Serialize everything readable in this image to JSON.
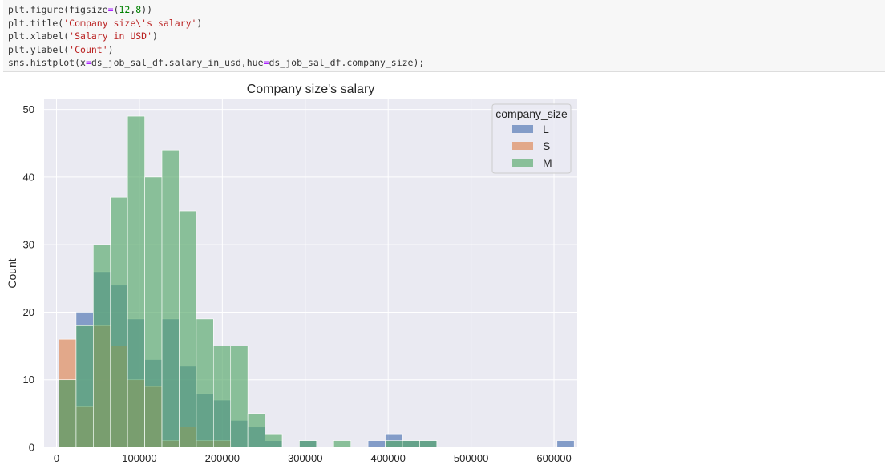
{
  "code": {
    "lines": [
      [
        {
          "t": "plt.figure(figsize",
          "c": ""
        },
        {
          "t": "=",
          "c": "eq"
        },
        {
          "t": "(",
          "c": ""
        },
        {
          "t": "12",
          "c": "num"
        },
        {
          "t": ",",
          "c": ""
        },
        {
          "t": "8",
          "c": "num"
        },
        {
          "t": "))",
          "c": ""
        }
      ],
      [
        {
          "t": "plt.title(",
          "c": ""
        },
        {
          "t": "'Company size\\'s salary'",
          "c": "str"
        },
        {
          "t": ")",
          "c": ""
        }
      ],
      [
        {
          "t": "plt.xlabel(",
          "c": ""
        },
        {
          "t": "'Salary in USD'",
          "c": "str"
        },
        {
          "t": ")",
          "c": ""
        }
      ],
      [
        {
          "t": "plt.ylabel(",
          "c": ""
        },
        {
          "t": "'Count'",
          "c": "str"
        },
        {
          "t": ")",
          "c": ""
        }
      ],
      [
        {
          "t": "sns.histplot(x",
          "c": ""
        },
        {
          "t": "=",
          "c": "eq"
        },
        {
          "t": "ds_job_sal_df.salary_in_usd,hue",
          "c": ""
        },
        {
          "t": "=",
          "c": "eq"
        },
        {
          "t": "ds_job_sal_df.company_size);",
          "c": ""
        }
      ]
    ]
  },
  "chart_data": {
    "type": "histogram",
    "title": "Company size's salary",
    "xlabel": "",
    "ylabel": "Count",
    "xlim": [
      -15000,
      628000
    ],
    "ylim": [
      0,
      51.5
    ],
    "xticks": [
      0,
      100000,
      200000,
      300000,
      400000,
      500000,
      600000
    ],
    "yticks": [
      0,
      10,
      20,
      30,
      40,
      50
    ],
    "bin_start": 2859,
    "bin_width": 20716,
    "grid": true,
    "legend": {
      "title": "company_size",
      "position": "top-right"
    },
    "series": [
      {
        "name": "L",
        "color": "#4c72b0",
        "values": [
          10,
          20,
          26,
          24,
          19,
          13,
          19,
          12,
          8,
          7,
          4,
          3,
          1,
          0,
          1,
          0,
          0,
          0,
          1,
          2,
          1,
          1,
          0,
          0,
          0,
          0,
          0,
          0,
          0,
          1
        ]
      },
      {
        "name": "S",
        "color": "#dd8452",
        "values": [
          16,
          6,
          18,
          15,
          10,
          9,
          1,
          3,
          1,
          1,
          0,
          0,
          0,
          0,
          0,
          0,
          0,
          0,
          0,
          0,
          0,
          0,
          0,
          0,
          0,
          0,
          0,
          0,
          0,
          0
        ]
      },
      {
        "name": "M",
        "color": "#55a868",
        "values": [
          10,
          18,
          30,
          37,
          49,
          40,
          44,
          35,
          19,
          15,
          15,
          5,
          2,
          0,
          1,
          0,
          1,
          0,
          0,
          1,
          1,
          1,
          0,
          0,
          0,
          0,
          0,
          0,
          0,
          0
        ]
      }
    ]
  }
}
